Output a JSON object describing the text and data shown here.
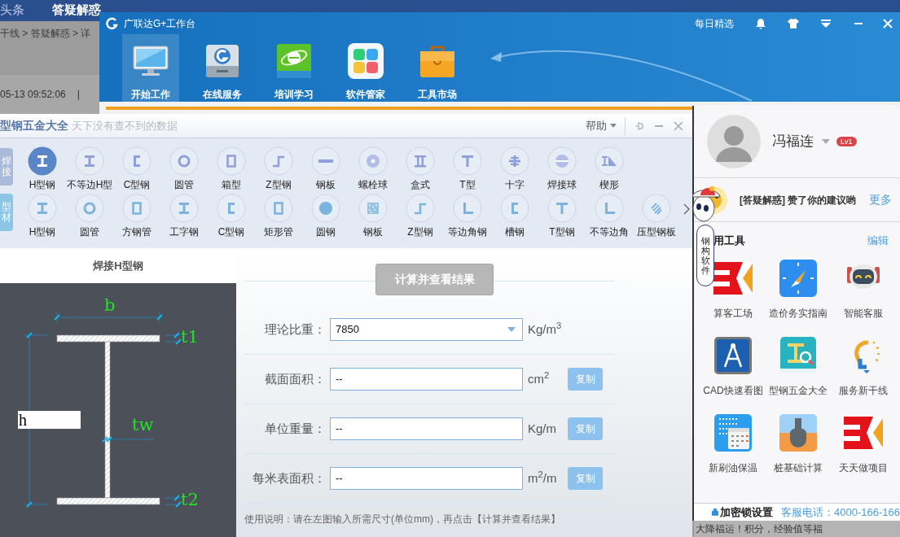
{
  "background_page": {
    "nav": [
      {
        "label": "头条",
        "selected": false
      },
      {
        "label": "答疑解惑",
        "selected": true
      }
    ],
    "breadcrumb": "干线 > 答疑解惑 > 详",
    "timestamp": "05-13 09:52:06",
    "separator": "|",
    "notice": "大降福运！积分，经验值等福"
  },
  "workbench": {
    "title": "广联达G+工作台",
    "daily_pick": "每日精选",
    "toolbar": [
      {
        "label": "开始工作",
        "kind": "monitor",
        "selected": true
      },
      {
        "label": "在线服务",
        "kind": "service",
        "selected": false
      },
      {
        "label": "培训学习",
        "kind": "browser",
        "selected": false
      },
      {
        "label": "软件管家",
        "kind": "apps",
        "selected": false
      },
      {
        "label": "工具市场",
        "kind": "briefcase",
        "selected": false
      }
    ]
  },
  "steel_tool": {
    "title": "型钢五金大全",
    "subtitle": "天下没有查不到的数据",
    "help": "帮助",
    "categories": [
      {
        "label": "焊接",
        "kind": "welded"
      },
      {
        "label": "型材",
        "kind": "profile"
      }
    ],
    "welded_sections": [
      {
        "label": "H型钢",
        "kind": "ibeam",
        "selected": true
      },
      {
        "label": "不等边H型",
        "kind": "ibeam",
        "selected": false
      },
      {
        "label": "C型钢",
        "kind": "channel",
        "selected": false
      },
      {
        "label": "圆管",
        "kind": "ring",
        "selected": false
      },
      {
        "label": "箱型",
        "kind": "box",
        "selected": false
      },
      {
        "label": "Z型钢",
        "kind": "z",
        "selected": false
      },
      {
        "label": "钢板",
        "kind": "plate",
        "selected": false
      },
      {
        "label": "螺栓球",
        "kind": "boltball",
        "selected": false
      },
      {
        "label": "盒式",
        "kind": "doublet",
        "selected": false
      },
      {
        "label": "T型",
        "kind": "tee",
        "selected": false
      },
      {
        "label": "十字",
        "kind": "cross",
        "selected": false
      },
      {
        "label": "焊接球",
        "kind": "weldball",
        "selected": false
      },
      {
        "label": "楔形",
        "kind": "wedge",
        "selected": false
      }
    ],
    "profile_sections": [
      {
        "label": "H型钢",
        "kind": "ibeam",
        "selected": false
      },
      {
        "label": "圆管",
        "kind": "ring",
        "selected": false
      },
      {
        "label": "方钢管",
        "kind": "box",
        "selected": false
      },
      {
        "label": "工字钢",
        "kind": "ibeam",
        "selected": false
      },
      {
        "label": "C型钢",
        "kind": "channel",
        "selected": false
      },
      {
        "label": "矩形管",
        "kind": "box",
        "selected": false
      },
      {
        "label": "圆钢",
        "kind": "disc",
        "selected": false
      },
      {
        "label": "钢板",
        "kind": "mesh",
        "selected": false
      },
      {
        "label": "Z型钢",
        "kind": "z",
        "selected": false
      },
      {
        "label": "等边角钢",
        "kind": "angle",
        "selected": false
      },
      {
        "label": "槽钢",
        "kind": "channel",
        "selected": false
      },
      {
        "label": "T型钢",
        "kind": "tee",
        "selected": false
      },
      {
        "label": "不等边角",
        "kind": "angle",
        "selected": false
      },
      {
        "label": "压型钢板",
        "kind": "corrugated",
        "selected": false
      }
    ],
    "panel_title": "焊接H型钢",
    "diagram": {
      "width_label": "b",
      "top_flange_label": "t1",
      "web_label": "tw",
      "bottom_flange_label": "t2",
      "height_input": "h"
    },
    "calculate_button": "计算并查看结果",
    "fields": [
      {
        "label": "理论比重：",
        "kind": "select",
        "value": "7850",
        "unit": "Kg/m$^{3}$"
      },
      {
        "label": "截面面积：",
        "kind": "text",
        "value": "--",
        "unit": "cm$^{2}$",
        "copy": "复制"
      },
      {
        "label": "单位重量：",
        "kind": "text",
        "value": "--",
        "unit": "Kg/m",
        "copy": "复制"
      },
      {
        "label": "每米表面积：",
        "kind": "text",
        "value": "--",
        "unit": "m$^{2}$/m",
        "copy": "复制"
      }
    ],
    "instructions": "使用说明：请在左图输入所需尺寸(单位mm)，再点击【计算并查看结果】"
  },
  "user_panel": {
    "name": "冯福连",
    "level": "Lv1",
    "notification": "[答疑解惑] 赞了你的建议哟",
    "more": "更多",
    "mascot_text": "钢构软件",
    "tools_title": "用工具",
    "edit": "编辑",
    "tools": [
      {
        "label": "算客工场",
        "kind": "bk"
      },
      {
        "label": "造价务实指南",
        "kind": "compass"
      },
      {
        "label": "智能客服",
        "kind": "robot"
      },
      {
        "label": "CAD快速看图",
        "kind": "cad"
      },
      {
        "label": "型钢五金大全",
        "kind": "book"
      },
      {
        "label": "服务新干线",
        "kind": "bulb"
      },
      {
        "label": "新刷油保温",
        "kind": "calendar"
      },
      {
        "label": "桩基础计算",
        "kind": "pile"
      },
      {
        "label": "天天做项目",
        "kind": "bk"
      }
    ],
    "lock_settings": "加密锁设置",
    "hotline": "客服电话：4000-166-166"
  }
}
